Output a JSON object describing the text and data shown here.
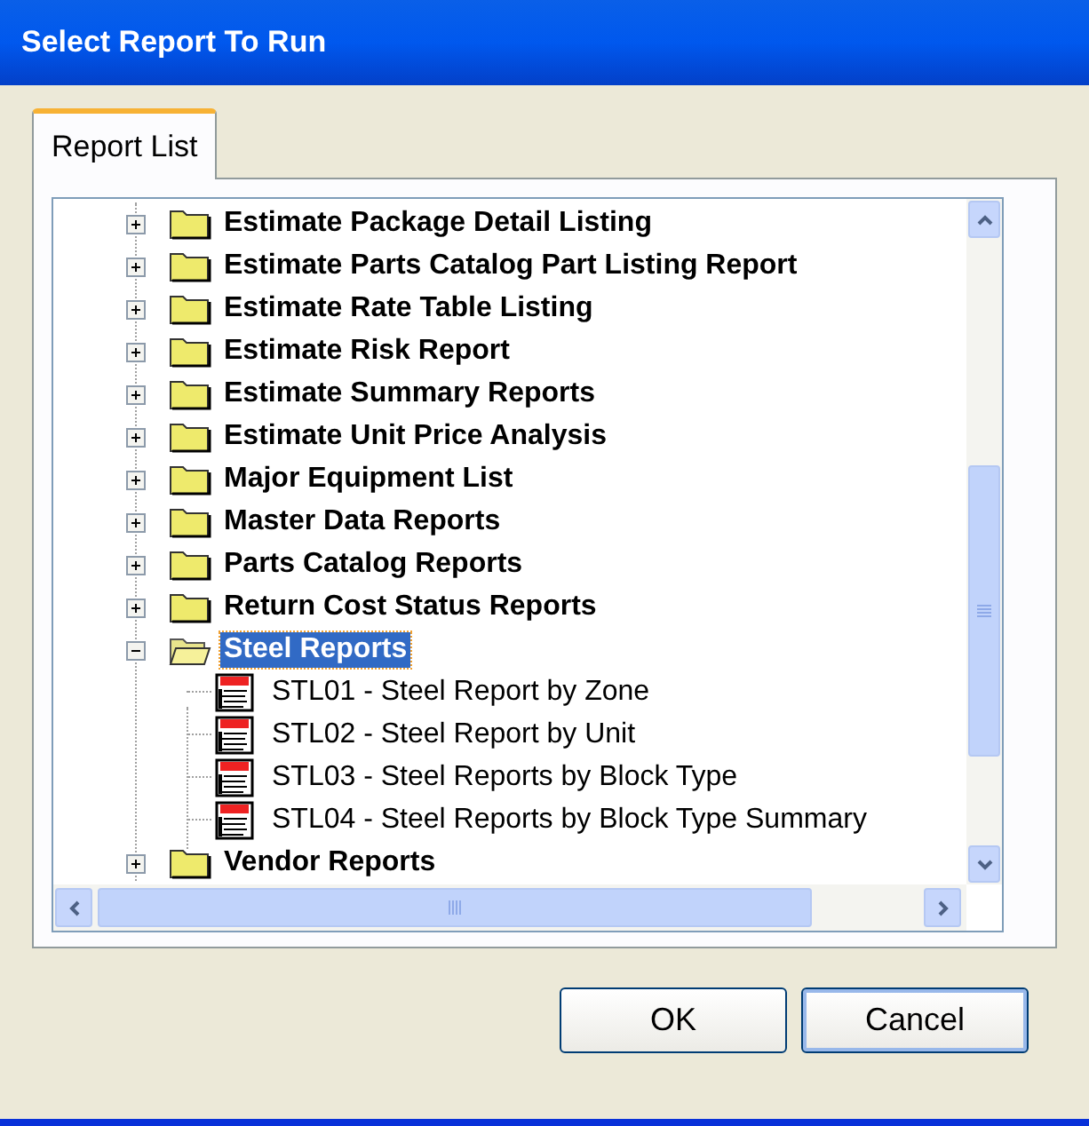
{
  "window": {
    "title": "Select Report To Run"
  },
  "tabs": [
    {
      "label": "Report List",
      "selected": true
    }
  ],
  "tree": [
    {
      "kind": "folder",
      "label": "Estimate Package Detail Listing",
      "expanded": false,
      "selected": false
    },
    {
      "kind": "folder",
      "label": "Estimate Parts Catalog Part Listing Report",
      "expanded": false,
      "selected": false
    },
    {
      "kind": "folder",
      "label": "Estimate Rate Table Listing",
      "expanded": false,
      "selected": false
    },
    {
      "kind": "folder",
      "label": "Estimate Risk Report",
      "expanded": false,
      "selected": false
    },
    {
      "kind": "folder",
      "label": "Estimate Summary Reports",
      "expanded": false,
      "selected": false
    },
    {
      "kind": "folder",
      "label": "Estimate Unit Price Analysis",
      "expanded": false,
      "selected": false
    },
    {
      "kind": "folder",
      "label": "Major Equipment List",
      "expanded": false,
      "selected": false
    },
    {
      "kind": "folder",
      "label": "Master Data Reports",
      "expanded": false,
      "selected": false
    },
    {
      "kind": "folder",
      "label": "Parts Catalog Reports",
      "expanded": false,
      "selected": false
    },
    {
      "kind": "folder",
      "label": "Return Cost Status Reports",
      "expanded": false,
      "selected": false
    },
    {
      "kind": "folder",
      "label": "Steel Reports",
      "expanded": true,
      "selected": true,
      "children": [
        {
          "kind": "report",
          "label": "STL01 - Steel Report by Zone",
          "selected": false
        },
        {
          "kind": "report",
          "label": "STL02 - Steel Report by Unit",
          "selected": false
        },
        {
          "kind": "report",
          "label": "STL03 - Steel Reports by Block Type",
          "selected": false
        },
        {
          "kind": "report",
          "label": "STL04 - Steel Reports by Block Type Summary",
          "selected": false
        }
      ]
    },
    {
      "kind": "folder",
      "label": "Vendor Reports",
      "expanded": false,
      "selected": false
    }
  ],
  "buttons": [
    {
      "label": "OK",
      "focused": false
    },
    {
      "label": "Cancel",
      "focused": true
    }
  ]
}
